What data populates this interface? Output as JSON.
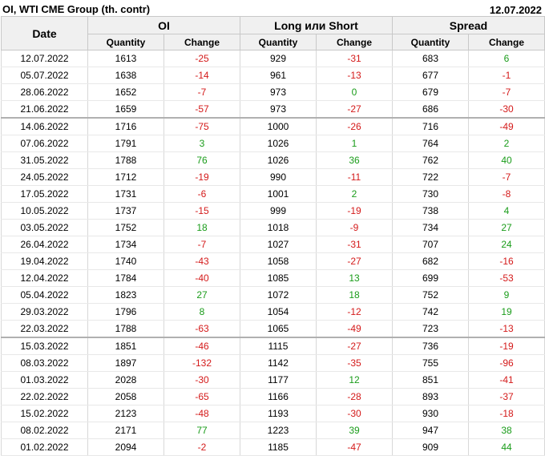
{
  "header": {
    "title": "OI, WTI CME Group (th. contr)",
    "date": "12.07.2022"
  },
  "columns": {
    "date": "Date",
    "groups": [
      "OI",
      "Long или Short",
      "Spread"
    ],
    "quantity": "Quantity",
    "change": "Change"
  },
  "colors": {
    "positive": "#1a9c1a",
    "negative": "#d41a1a"
  },
  "rows": [
    {
      "date": "12.07.2022",
      "oi_q": "1613",
      "oi_c": "-25",
      "ls_q": "929",
      "ls_c": "-31",
      "sp_q": "683",
      "sp_c": "6"
    },
    {
      "date": "05.07.2022",
      "oi_q": "1638",
      "oi_c": "-14",
      "ls_q": "961",
      "ls_c": "-13",
      "sp_q": "677",
      "sp_c": "-1"
    },
    {
      "date": "28.06.2022",
      "oi_q": "1652",
      "oi_c": "-7",
      "ls_q": "973",
      "ls_c": "0",
      "sp_q": "679",
      "sp_c": "-7"
    },
    {
      "date": "21.06.2022",
      "oi_q": "1659",
      "oi_c": "-57",
      "ls_q": "973",
      "ls_c": "-27",
      "sp_q": "686",
      "sp_c": "-30"
    },
    {
      "date": "14.06.2022",
      "oi_q": "1716",
      "oi_c": "-75",
      "ls_q": "1000",
      "ls_c": "-26",
      "sp_q": "716",
      "sp_c": "-49",
      "sep": true
    },
    {
      "date": "07.06.2022",
      "oi_q": "1791",
      "oi_c": "3",
      "ls_q": "1026",
      "ls_c": "1",
      "sp_q": "764",
      "sp_c": "2"
    },
    {
      "date": "31.05.2022",
      "oi_q": "1788",
      "oi_c": "76",
      "ls_q": "1026",
      "ls_c": "36",
      "sp_q": "762",
      "sp_c": "40"
    },
    {
      "date": "24.05.2022",
      "oi_q": "1712",
      "oi_c": "-19",
      "ls_q": "990",
      "ls_c": "-11",
      "sp_q": "722",
      "sp_c": "-7"
    },
    {
      "date": "17.05.2022",
      "oi_q": "1731",
      "oi_c": "-6",
      "ls_q": "1001",
      "ls_c": "2",
      "sp_q": "730",
      "sp_c": "-8"
    },
    {
      "date": "10.05.2022",
      "oi_q": "1737",
      "oi_c": "-15",
      "ls_q": "999",
      "ls_c": "-19",
      "sp_q": "738",
      "sp_c": "4"
    },
    {
      "date": "03.05.2022",
      "oi_q": "1752",
      "oi_c": "18",
      "ls_q": "1018",
      "ls_c": "-9",
      "sp_q": "734",
      "sp_c": "27"
    },
    {
      "date": "26.04.2022",
      "oi_q": "1734",
      "oi_c": "-7",
      "ls_q": "1027",
      "ls_c": "-31",
      "sp_q": "707",
      "sp_c": "24"
    },
    {
      "date": "19.04.2022",
      "oi_q": "1740",
      "oi_c": "-43",
      "ls_q": "1058",
      "ls_c": "-27",
      "sp_q": "682",
      "sp_c": "-16"
    },
    {
      "date": "12.04.2022",
      "oi_q": "1784",
      "oi_c": "-40",
      "ls_q": "1085",
      "ls_c": "13",
      "sp_q": "699",
      "sp_c": "-53"
    },
    {
      "date": "05.04.2022",
      "oi_q": "1823",
      "oi_c": "27",
      "ls_q": "1072",
      "ls_c": "18",
      "sp_q": "752",
      "sp_c": "9"
    },
    {
      "date": "29.03.2022",
      "oi_q": "1796",
      "oi_c": "8",
      "ls_q": "1054",
      "ls_c": "-12",
      "sp_q": "742",
      "sp_c": "19"
    },
    {
      "date": "22.03.2022",
      "oi_q": "1788",
      "oi_c": "-63",
      "ls_q": "1065",
      "ls_c": "-49",
      "sp_q": "723",
      "sp_c": "-13"
    },
    {
      "date": "15.03.2022",
      "oi_q": "1851",
      "oi_c": "-46",
      "ls_q": "1115",
      "ls_c": "-27",
      "sp_q": "736",
      "sp_c": "-19",
      "sep": true
    },
    {
      "date": "08.03.2022",
      "oi_q": "1897",
      "oi_c": "-132",
      "ls_q": "1142",
      "ls_c": "-35",
      "sp_q": "755",
      "sp_c": "-96"
    },
    {
      "date": "01.03.2022",
      "oi_q": "2028",
      "oi_c": "-30",
      "ls_q": "1177",
      "ls_c": "12",
      "sp_q": "851",
      "sp_c": "-41"
    },
    {
      "date": "22.02.2022",
      "oi_q": "2058",
      "oi_c": "-65",
      "ls_q": "1166",
      "ls_c": "-28",
      "sp_q": "893",
      "sp_c": "-37"
    },
    {
      "date": "15.02.2022",
      "oi_q": "2123",
      "oi_c": "-48",
      "ls_q": "1193",
      "ls_c": "-30",
      "sp_q": "930",
      "sp_c": "-18"
    },
    {
      "date": "08.02.2022",
      "oi_q": "2171",
      "oi_c": "77",
      "ls_q": "1223",
      "ls_c": "39",
      "sp_q": "947",
      "sp_c": "38"
    },
    {
      "date": "01.02.2022",
      "oi_q": "2094",
      "oi_c": "-2",
      "ls_q": "1185",
      "ls_c": "-47",
      "sp_q": "909",
      "sp_c": "44"
    }
  ]
}
